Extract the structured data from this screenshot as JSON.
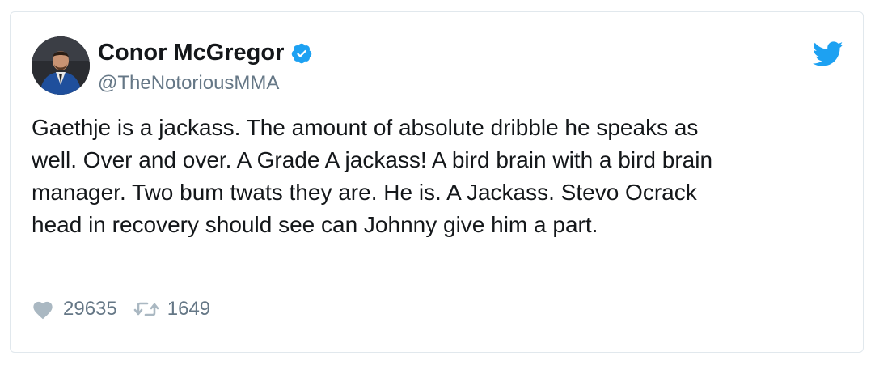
{
  "tweet": {
    "author_name": "Conor McGregor",
    "author_handle": "@TheNotoriousMMA",
    "verified": true,
    "text_lines": [
      "Gaethje is a jackass. The amount of absolute dribble he speaks as",
      "well. Over and over. A Grade A jackass! A bird brain with a bird brain",
      "manager. Two bum twats they are. He is. A Jackass. Stevo Ocrack",
      "head in recovery should see can Johnny give him a part."
    ],
    "likes": "29635",
    "retweets": "1649"
  },
  "icons": {
    "verified": "verified-badge-icon",
    "brand": "twitter-bird-icon",
    "like": "heart-icon",
    "retweet": "retweet-icon"
  },
  "colors": {
    "brand_blue": "#1da1f2",
    "text_primary": "#14171a",
    "text_secondary": "#657786",
    "action_icon": "#aab8c2",
    "border": "#e1e8ed"
  }
}
